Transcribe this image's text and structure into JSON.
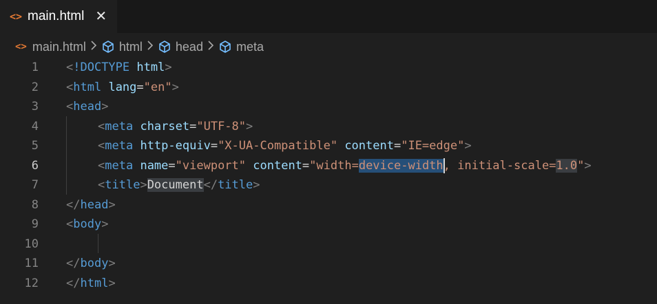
{
  "tab": {
    "icon": "<>",
    "icon_name": "html-file-icon",
    "label": "main.html",
    "close": "✕"
  },
  "breadcrumb": {
    "items": [
      {
        "label": "main.html",
        "icon": "html-file-icon"
      },
      {
        "label": "html",
        "icon": "symbol-cube-icon"
      },
      {
        "label": "head",
        "icon": "symbol-cube-icon"
      },
      {
        "label": "meta",
        "icon": "symbol-cube-icon"
      }
    ]
  },
  "editor": {
    "active_line": 6,
    "lines": [
      {
        "num": "1"
      },
      {
        "num": "2"
      },
      {
        "num": "3"
      },
      {
        "num": "4"
      },
      {
        "num": "5"
      },
      {
        "num": "6"
      },
      {
        "num": "7"
      },
      {
        "num": "8"
      },
      {
        "num": "9"
      },
      {
        "num": "10"
      },
      {
        "num": "11"
      },
      {
        "num": "12"
      }
    ],
    "tokens": {
      "l1_doctype": "!DOCTYPE",
      "l1_html": "html",
      "l2_tag": "html",
      "l2_attr": "lang",
      "l2_val": "\"en\"",
      "l3_tag": "head",
      "l4_tag": "meta",
      "l4_attr": "charset",
      "l4_val": "\"UTF-8\"",
      "l5_tag": "meta",
      "l5_attr1": "http-equiv",
      "l5_val1": "\"X-UA-Compatible\"",
      "l5_attr2": "content",
      "l5_val2": "\"IE=edge\"",
      "l6_tag": "meta",
      "l6_attr1": "name",
      "l6_val1": "\"viewport\"",
      "l6_attr2": "content",
      "l6_val2_a": "\"width=",
      "l6_val2_sel": "device-width",
      "l6_val2_b": ", initial-scale=",
      "l6_val2_hl": "1.0",
      "l6_val2_c": "\"",
      "l7_tag_open": "title",
      "l7_text": "Document",
      "l7_tag_close": "title",
      "l8_tag": "head",
      "l9_tag": "body",
      "l11_tag": "body",
      "l12_tag": "html"
    }
  },
  "colors": {
    "background": "#1f1f1f",
    "tabbar": "#181818",
    "tag": "#569cd6",
    "attribute": "#9cdcfe",
    "string": "#ce9178",
    "bracket": "#808080",
    "selection": "#264f78",
    "html_icon": "#e37933"
  }
}
